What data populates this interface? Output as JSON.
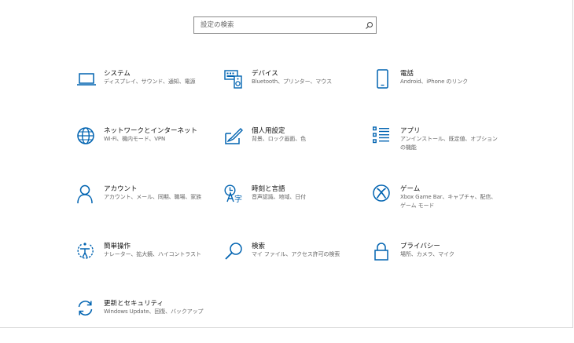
{
  "search": {
    "placeholder": "設定の検索"
  },
  "accent_color": "#0063b1",
  "tiles": [
    {
      "icon": "laptop-icon",
      "title": "システム",
      "desc": "ディスプレイ、サウンド、通知、電源"
    },
    {
      "icon": "keyboard-speaker-icon",
      "title": "デバイス",
      "desc": "Bluetooth、プリンター、マウス"
    },
    {
      "icon": "phone-icon",
      "title": "電話",
      "desc": "Android、iPhone のリンク"
    },
    {
      "icon": "globe-icon",
      "title": "ネットワークとインターネット",
      "desc": "Wi-Fi、機内モード、VPN"
    },
    {
      "icon": "paintbrush-icon",
      "title": "個人用設定",
      "desc": "背景、ロック画面、色"
    },
    {
      "icon": "apps-list-icon",
      "title": "アプリ",
      "desc": "アンインストール、既定値、オプションの機能"
    },
    {
      "icon": "person-icon",
      "title": "アカウント",
      "desc": "アカウント、メール、同期、職場、家族"
    },
    {
      "icon": "time-language-icon",
      "title": "時刻と言語",
      "desc": "音声認識、地域、日付"
    },
    {
      "icon": "xbox-icon",
      "title": "ゲーム",
      "desc": "Xbox Game Bar、キャプチャ、配信、ゲーム モード"
    },
    {
      "icon": "ease-of-access-icon",
      "title": "簡単操作",
      "desc": "ナレーター、拡大鏡、ハイコントラスト"
    },
    {
      "icon": "magnifier-icon",
      "title": "検索",
      "desc": "マイ ファイル、アクセス許可の検索"
    },
    {
      "icon": "lock-icon",
      "title": "プライバシー",
      "desc": "場所、カメラ、マイク"
    },
    {
      "icon": "sync-arrows-icon",
      "title": "更新とセキュリティ",
      "desc": "Windows Update、回復、バックアップ"
    }
  ]
}
